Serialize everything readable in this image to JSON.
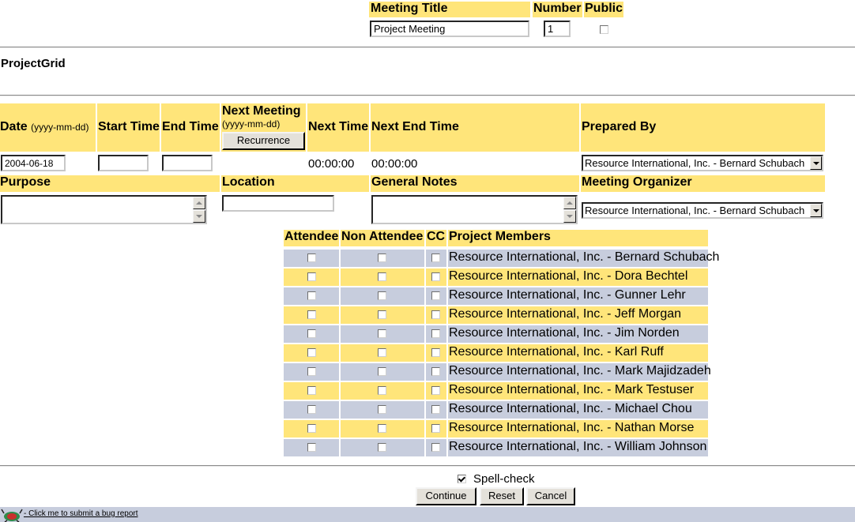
{
  "top": {
    "meeting_title_label": "Meeting Title",
    "number_label": "Number",
    "public_label": "Public",
    "meeting_title_value": "Project Meeting",
    "number_value": "1"
  },
  "project_grid_title": "ProjectGrid",
  "headers": {
    "date": "Date",
    "date_hint": "(yyyy-mm-dd)",
    "start_time": "Start Time",
    "end_time": "End Time",
    "next_meeting": "Next Meeting",
    "next_meeting_hint": "(yyyy-mm-dd)",
    "recurrence_button": "Recurrence",
    "next_time": "Next Time",
    "next_end_time": "Next End Time",
    "prepared_by": "Prepared By",
    "purpose": "Purpose",
    "location": "Location",
    "general_notes": "General Notes",
    "meeting_organizer": "Meeting Organizer"
  },
  "values": {
    "date": "2004-06-18",
    "start_time": "",
    "end_time": "",
    "next_time": "00:00:00",
    "next_end_time": "00:00:00",
    "prepared_by": "Resource International, Inc. - Bernard Schubach",
    "location": "",
    "meeting_organizer": "Resource International, Inc. - Bernard Schubach"
  },
  "members_table": {
    "headers": [
      "Attendee",
      "Non Attendee",
      "CC",
      "Project Members"
    ],
    "rows": [
      "Resource International, Inc. - Bernard Schubach",
      "Resource International, Inc. - Dora Bechtel",
      "Resource International, Inc. - Gunner Lehr",
      "Resource International, Inc. - Jeff Morgan",
      "Resource International, Inc. - Jim Norden",
      "Resource International, Inc. - Karl Ruff",
      "Resource International, Inc. - Mark Majidzadeh",
      "Resource International, Inc. - Mark Testuser",
      "Resource International, Inc. - Michael Chou",
      "Resource International, Inc. - Nathan Morse",
      "Resource International, Inc. - William Johnson"
    ]
  },
  "bottom": {
    "spellcheck_label": "Spell-check",
    "continue": "Continue",
    "reset": "Reset",
    "cancel": "Cancel"
  },
  "footer": {
    "bug_link": "- Click me to submit a bug report"
  },
  "colors": {
    "header_yellow": "#ffe57a",
    "row_blue": "#c7cddd",
    "row_yellow": "#ffe57a"
  }
}
